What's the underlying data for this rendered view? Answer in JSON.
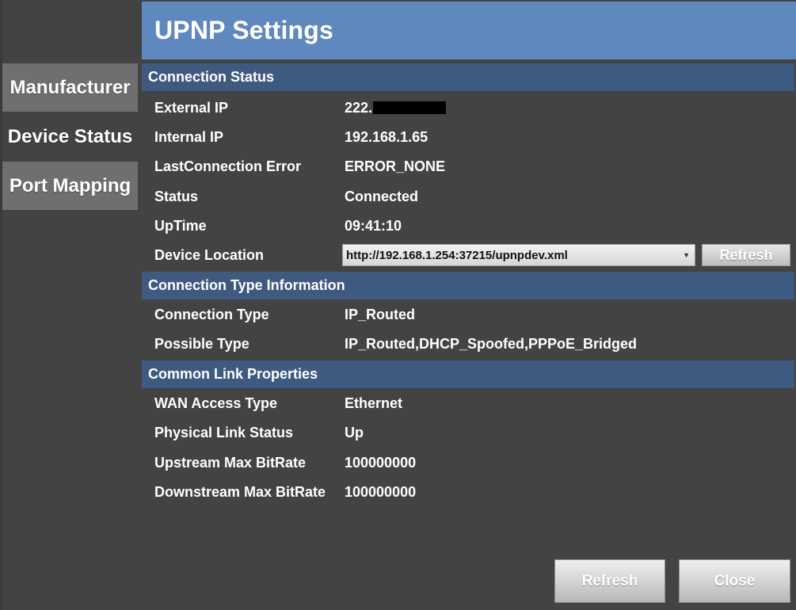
{
  "header": {
    "title": "UPNP Settings"
  },
  "sidebar": {
    "items": [
      {
        "label": "Manufacturer"
      },
      {
        "label": "Device Status"
      },
      {
        "label": "Port Mapping"
      }
    ]
  },
  "sections": {
    "connection_status": {
      "title": "Connection Status",
      "rows": [
        {
          "label": "External IP",
          "value": "222."
        },
        {
          "label": "Internal IP",
          "value": "192.168.1.65"
        },
        {
          "label": "LastConnection Error",
          "value": "ERROR_NONE"
        },
        {
          "label": "Status",
          "value": "Connected"
        },
        {
          "label": "UpTime",
          "value": "09:41:10"
        },
        {
          "label": "Device Location",
          "value": "http://192.168.1.254:37215/upnpdev.xml"
        }
      ],
      "refresh_label": "Refresh"
    },
    "connection_type": {
      "title": "Connection Type Information",
      "rows": [
        {
          "label": "Connection Type",
          "value": "IP_Routed"
        },
        {
          "label": "Possible Type",
          "value": "IP_Routed,DHCP_Spoofed,PPPoE_Bridged"
        }
      ]
    },
    "link_properties": {
      "title": "Common Link Properties",
      "rows": [
        {
          "label": "WAN Access Type",
          "value": "Ethernet"
        },
        {
          "label": "Physical Link Status",
          "value": "Up"
        },
        {
          "label": "Upstream Max BitRate",
          "value": "100000000"
        },
        {
          "label": "Downstream Max BitRate",
          "value": "100000000"
        }
      ]
    }
  },
  "footer": {
    "refresh_label": "Refresh",
    "close_label": "Close"
  },
  "colors": {
    "background": "#434343",
    "header": "#5f88bf",
    "section": "#3f5a80",
    "tab": "#6f6f6f"
  }
}
